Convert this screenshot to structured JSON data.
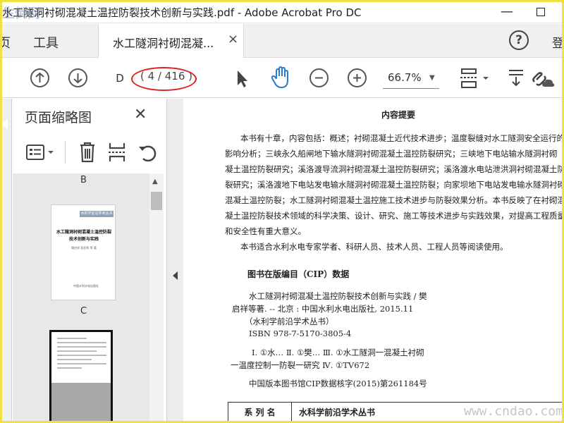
{
  "window": {
    "title": "水工隧洞衬砌混凝土温控防裂技术创新与实践.pdf - Adobe Acrobat Pro DC",
    "watermark_logo": "生倒网"
  },
  "tabs": {
    "home": "页",
    "tools": "工具",
    "document": "水工隧洞衬砌混凝...",
    "close": "×",
    "help": "?",
    "signin": "登"
  },
  "toolbar": {
    "page_input": "D",
    "page_count": "( 4 / 416 )",
    "zoom": "66.7%",
    "highlight_color": "#e02020"
  },
  "panel": {
    "title": "页面缩略图",
    "close": "✕",
    "labels": [
      "B",
      "C"
    ],
    "thumb_c": {
      "band": "水利学前沿学术丛书",
      "title": "水工隧洞衬砌混凝土温控防裂技术创新与实践",
      "authors": "樊启祥 段亚辉 等 著",
      "publisher": "中国水利水电出版社"
    }
  },
  "document": {
    "abstract_title": "内容提要",
    "abstract_lines": [
      "本书有十章，内容包括：概述；衬砌混凝土近代技术进步；温度裂缝对水工隧洞安全运行的",
      "影响分析；三峡永久船闸地下输水隧洞衬砌混凝土温控防裂研究；三峡地下电站输水隧洞衬砌",
      "凝土温控防裂研究；溪洛渡导流洞衬砌混凝土温控防裂研究；溪洛渡水电站泄洪洞衬砌混凝土防",
      "裂研究；溪洛渡地下电站发电输水隧洞衬砌混凝土温控防裂；向家坝地下电站发电输水隧洞衬砌",
      "混凝土温控防裂；水工隧洞衬砌混凝土温控施工技术进步与防裂效果分析。本书反映了在衬砌混",
      "凝土温控防裂技术领域的科学决策、设计、研究、施工等技术进步与实践效果，对提高工程质量",
      "和安全性有重大意义。",
      "本书适合水利水电专家学者、科研人员、技术人员、工程人员等阅读使用。"
    ],
    "cip_title": "图书在版编目（CIP）数据",
    "cip_lines": [
      "水工隧洞衬砌混凝土温控防裂技术创新与实践 / 樊",
      "启祥等著. -- 北京 : 中国水利水电出版社, 2015.11",
      "（水利学前沿学术丛书）",
      "ISBN 978-7-5170-3805-4",
      "Ⅰ. ①水… Ⅱ. ①樊… Ⅲ. ①水工隧洞一混凝土衬砌",
      "一温度控制一防裂一研究 Ⅳ. ①TV672",
      "中国版本图书馆CIP数据核字(2015)第261184号"
    ],
    "series_label": "系 列 名",
    "series_value": "水科学前沿学术丛书"
  },
  "watermark_site": "www.cndao.com"
}
